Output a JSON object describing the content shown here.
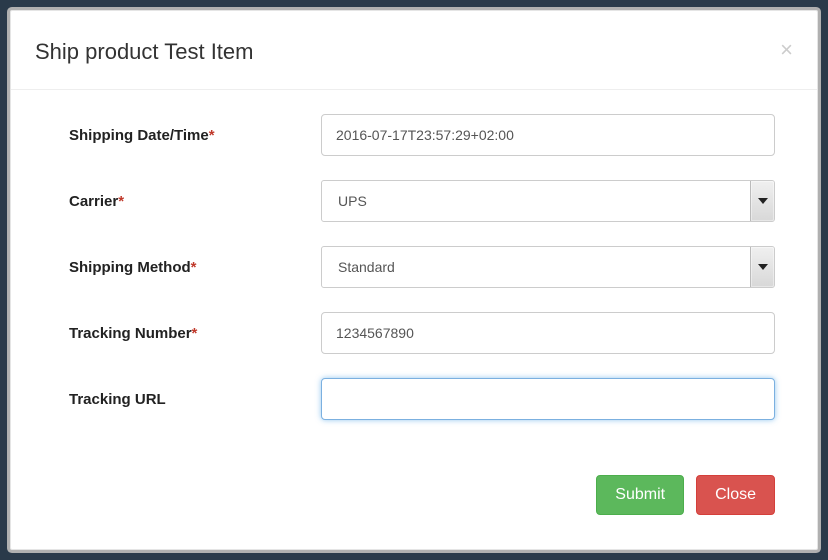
{
  "modal": {
    "title": "Ship product Test Item",
    "close_symbol": "×",
    "form": {
      "shipping_date_label": "Shipping Date/Time",
      "shipping_date_value": "2016-07-17T23:57:29+02:00",
      "carrier_label": "Carrier",
      "carrier_value": "UPS",
      "shipping_method_label": "Shipping Method",
      "shipping_method_value": "Standard",
      "tracking_number_label": "Tracking Number",
      "tracking_number_value": "1234567890",
      "tracking_url_label": "Tracking URL",
      "tracking_url_value": ""
    },
    "buttons": {
      "submit": "Submit",
      "close": "Close"
    }
  }
}
